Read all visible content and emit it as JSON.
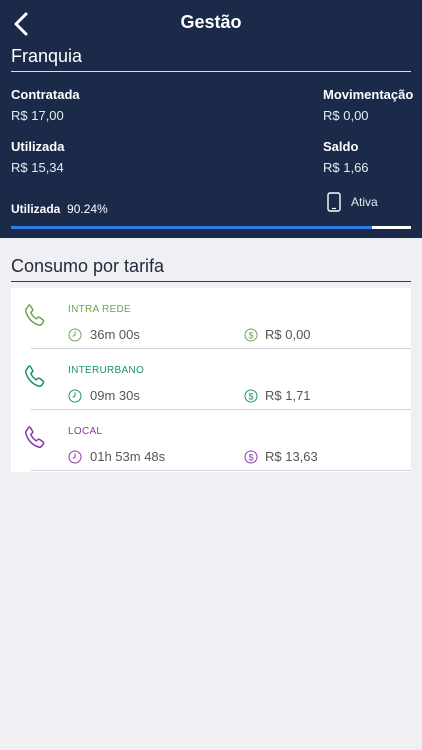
{
  "header": {
    "title": "Gestão",
    "section": "Franquia",
    "contratada_label": "Contratada",
    "contratada_value": "R$ 17,00",
    "movimentacao_label": "Movimentação",
    "movimentacao_value": "R$ 0,00",
    "utilizada_label": "Utilizada",
    "utilizada_value": "R$ 15,34",
    "saldo_label": "Saldo",
    "saldo_value": "R$ 1,66",
    "status": "Ativa",
    "usage_label": "Utilizada",
    "usage_percent_text": "90.24%",
    "usage_fraction": 0.9024
  },
  "consumo": {
    "title": "Consumo por tarifa",
    "rows": [
      {
        "name": "INTRA REDE",
        "duration": "36m 00s",
        "cost": "R$ 0,00",
        "color": "#6aa84f"
      },
      {
        "name": "INTERURBANO",
        "duration": "09m 30s",
        "cost": "R$ 1,71",
        "color": "#1f8f73"
      },
      {
        "name": "LOCAL",
        "duration": "01h 53m 48s",
        "cost": "R$ 13,63",
        "color": "#8a3aa6"
      }
    ]
  },
  "colors": {
    "header_bg": "#1b2a48",
    "progress": "#2f7cf0",
    "page_bg": "#efeff4"
  },
  "icons": {
    "back": "chevron-left-icon",
    "device": "smartphone-icon",
    "call": "phone-icon",
    "duration": "clock-icon",
    "cost": "dollar-coin-icon"
  }
}
